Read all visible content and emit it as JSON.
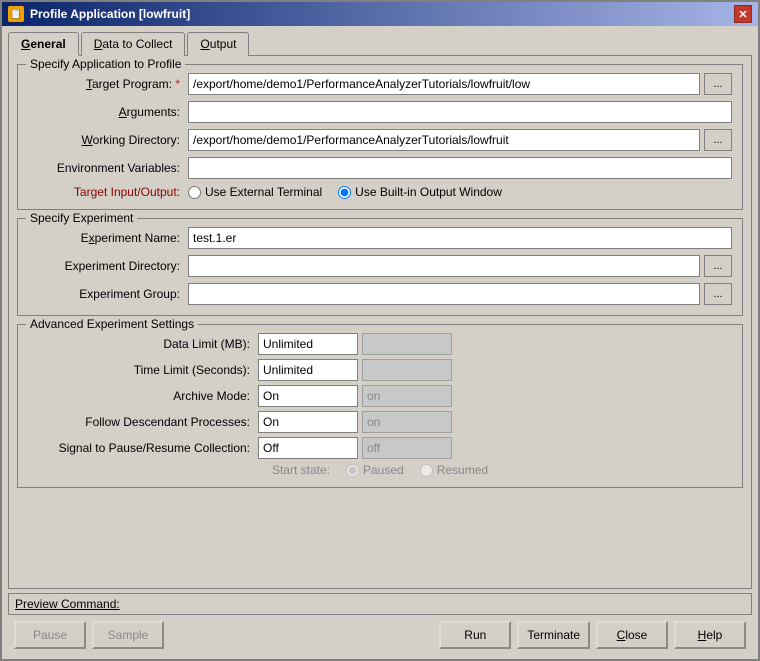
{
  "window": {
    "title": "Profile Application [lowfruit]",
    "icon": "📋"
  },
  "tabs": [
    {
      "label": "General",
      "underline": "G",
      "active": true
    },
    {
      "label": "Data to Collect",
      "underline": "D",
      "active": false
    },
    {
      "label": "Output",
      "underline": "O",
      "active": false
    }
  ],
  "specify_app": {
    "section_title": "Specify Application to Profile",
    "target_label": "Target Program:",
    "target_required": "*",
    "target_value": "/export/home/demo1/PerformanceAnalyzerTutorials/lowfruit/low",
    "arguments_label": "Arguments:",
    "arguments_value": "",
    "working_dir_label": "Working Directory:",
    "working_dir_value": "/export/home/demo1/PerformanceAnalyzerTutorials/lowfruit",
    "env_vars_label": "Environment Variables:",
    "env_vars_value": "",
    "target_io_label": "Target Input/Output:",
    "radio_external": "Use External Terminal",
    "radio_builtin": "Use Built-in Output Window",
    "browse_label": "..."
  },
  "specify_experiment": {
    "section_title": "Specify Experiment",
    "exp_name_label": "Experiment Name:",
    "exp_name_value": "test.1.er",
    "exp_dir_label": "Experiment Directory:",
    "exp_dir_value": "",
    "exp_group_label": "Experiment Group:",
    "exp_group_value": ""
  },
  "advanced": {
    "section_title": "Advanced Experiment Settings",
    "data_limit_label": "Data Limit (MB):",
    "data_limit_value": "Unlimited",
    "data_limit_extra": "",
    "time_limit_label": "Time Limit (Seconds):",
    "time_limit_value": "Unlimited",
    "time_limit_extra": "",
    "archive_mode_label": "Archive Mode:",
    "archive_mode_value": "On",
    "archive_mode_extra": "on",
    "follow_desc_label": "Follow Descendant Processes:",
    "follow_desc_value": "On",
    "follow_desc_extra": "on",
    "signal_label": "Signal to Pause/Resume Collection:",
    "signal_value": "Off",
    "signal_extra": "off",
    "start_state_label": "Start state:",
    "radio_paused": "Paused",
    "radio_resumed": "Resumed"
  },
  "preview": {
    "label": "Preview Command:"
  },
  "buttons": {
    "pause": "Pause",
    "sample": "Sample",
    "run": "Run",
    "terminate": "Terminate",
    "close": "Close",
    "help": "Help"
  }
}
